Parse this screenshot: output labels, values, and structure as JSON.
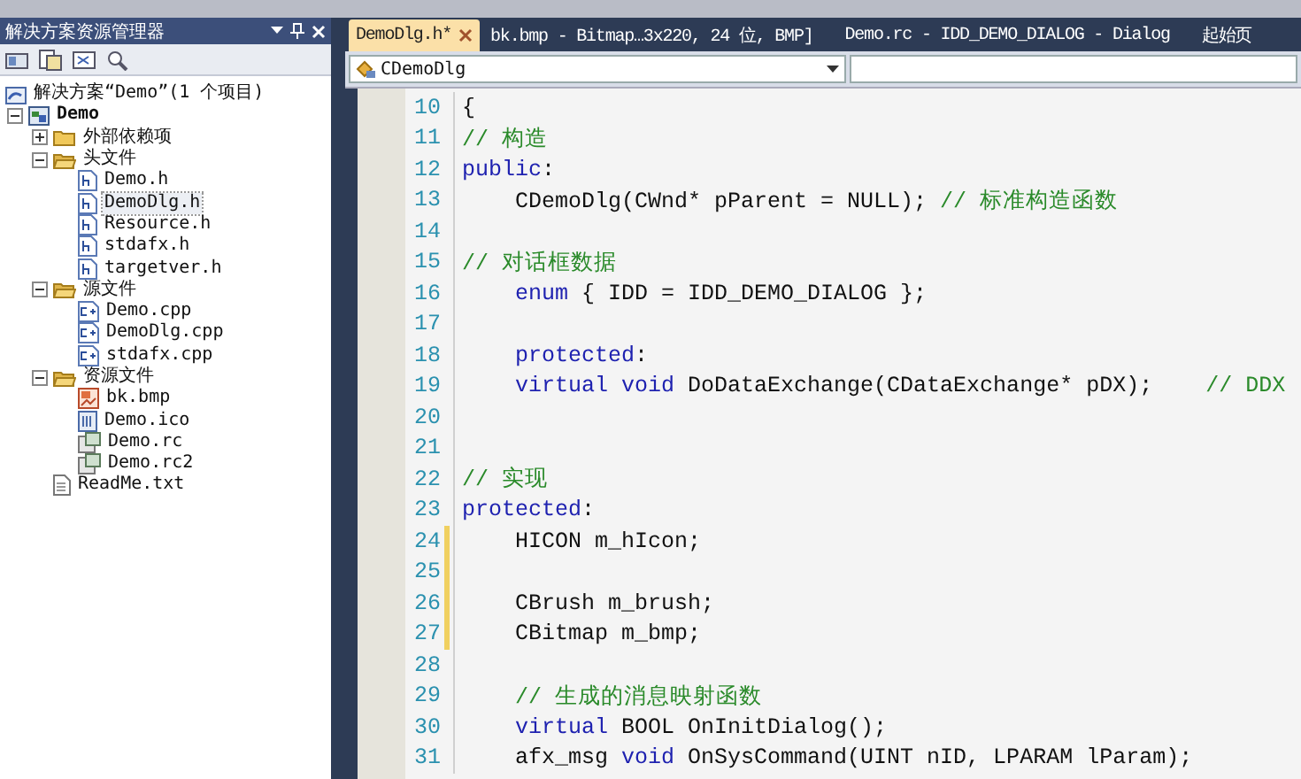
{
  "explorer": {
    "title": "解决方案资源管理器",
    "tree": [
      {
        "kind": "solution",
        "label": "解决方案“Demo”(1 个项目)",
        "selected": false,
        "children": [
          {
            "kind": "project",
            "label": "Demo",
            "selected": false,
            "expanded": true,
            "children": [
              {
                "kind": "folder",
                "label": "外部依赖项",
                "selected": false,
                "expanded": false
              },
              {
                "kind": "folder",
                "label": "头文件",
                "selected": false,
                "expanded": true,
                "children": [
                  {
                    "kind": "header",
                    "label": "Demo.h",
                    "selected": false
                  },
                  {
                    "kind": "header",
                    "label": "DemoDlg.h",
                    "selected": true
                  },
                  {
                    "kind": "header",
                    "label": "Resource.h",
                    "selected": false
                  },
                  {
                    "kind": "header",
                    "label": "stdafx.h",
                    "selected": false
                  },
                  {
                    "kind": "header",
                    "label": "targetver.h",
                    "selected": false
                  }
                ]
              },
              {
                "kind": "folder",
                "label": "源文件",
                "selected": false,
                "expanded": true,
                "children": [
                  {
                    "kind": "source",
                    "label": "Demo.cpp",
                    "selected": false
                  },
                  {
                    "kind": "source",
                    "label": "DemoDlg.cpp",
                    "selected": false
                  },
                  {
                    "kind": "source",
                    "label": "stdafx.cpp",
                    "selected": false
                  }
                ]
              },
              {
                "kind": "folder",
                "label": "资源文件",
                "selected": false,
                "expanded": true,
                "children": [
                  {
                    "kind": "bitmap",
                    "label": "bk.bmp",
                    "selected": false
                  },
                  {
                    "kind": "icon",
                    "label": "Demo.ico",
                    "selected": false
                  },
                  {
                    "kind": "resource",
                    "label": "Demo.rc",
                    "selected": false
                  },
                  {
                    "kind": "resource",
                    "label": "Demo.rc2",
                    "selected": false
                  }
                ]
              },
              {
                "kind": "text",
                "label": "ReadMe.txt",
                "selected": false
              }
            ]
          }
        ]
      }
    ]
  },
  "tabs": [
    {
      "label": "DemoDlg.h*",
      "selected": true
    },
    {
      "label": "bk.bmp - Bitmap…3x220, 24 位, BMP]",
      "selected": false
    },
    {
      "label": "Demo.rc - IDD_DEMO_DIALOG - Dialog",
      "selected": false
    },
    {
      "label": "起始页",
      "selected": false
    }
  ],
  "navigation": {
    "class_name": "CDemoDlg"
  },
  "code_lines": [
    {
      "number": "10",
      "changed": false,
      "tokens": [
        {
          "kind": "plain",
          "text": "{"
        }
      ]
    },
    {
      "number": "11",
      "changed": false,
      "tokens": [
        {
          "kind": "comment",
          "text": "// 构造"
        }
      ]
    },
    {
      "number": "12",
      "changed": false,
      "tokens": [
        {
          "kind": "keyword",
          "text": "public"
        },
        {
          "kind": "plain",
          "text": ":"
        }
      ]
    },
    {
      "number": "13",
      "changed": false,
      "tokens": [
        {
          "kind": "plain",
          "text": "    CDemoDlg(CWnd* pParent = NULL); "
        },
        {
          "kind": "comment",
          "text": "// 标准构造函数"
        }
      ]
    },
    {
      "number": "14",
      "changed": false
    },
    {
      "number": "15",
      "changed": false,
      "tokens": [
        {
          "kind": "comment",
          "text": "// 对话框数据"
        }
      ]
    },
    {
      "number": "16",
      "changed": false,
      "tokens": [
        {
          "kind": "keyword",
          "text": "    enum"
        },
        {
          "kind": "plain",
          "text": " { IDD = IDD_DEMO_DIALOG };"
        }
      ]
    },
    {
      "number": "17",
      "changed": false
    },
    {
      "number": "18",
      "changed": false,
      "tokens": [
        {
          "kind": "keyword",
          "text": "    protected"
        },
        {
          "kind": "plain",
          "text": ":"
        }
      ]
    },
    {
      "number": "19",
      "changed": false,
      "tokens": [
        {
          "kind": "keyword",
          "text": "    virtual void"
        },
        {
          "kind": "plain",
          "text": " DoDataExchange(CDataExchange* pDX);    "
        },
        {
          "kind": "comment",
          "text": "// DDX"
        }
      ]
    },
    {
      "number": "20",
      "changed": false
    },
    {
      "number": "21",
      "changed": false
    },
    {
      "number": "22",
      "changed": false,
      "tokens": [
        {
          "kind": "comment",
          "text": "// 实现"
        }
      ]
    },
    {
      "number": "23",
      "changed": false,
      "tokens": [
        {
          "kind": "keyword",
          "text": "protected"
        },
        {
          "kind": "plain",
          "text": ":"
        }
      ]
    },
    {
      "number": "24",
      "changed": true,
      "tokens": [
        {
          "kind": "plain",
          "text": "    HICON m_hIcon;"
        }
      ]
    },
    {
      "number": "25",
      "changed": true
    },
    {
      "number": "26",
      "changed": true,
      "tokens": [
        {
          "kind": "plain",
          "text": "    CBrush m_brush;"
        }
      ]
    },
    {
      "number": "27",
      "changed": true,
      "tokens": [
        {
          "kind": "plain",
          "text": "    CBitmap m_bmp;"
        }
      ]
    },
    {
      "number": "28",
      "changed": false
    },
    {
      "number": "29",
      "changed": false,
      "tokens": [
        {
          "kind": "comment",
          "text": "    // 生成的消息映射函数"
        }
      ]
    },
    {
      "number": "30",
      "changed": false,
      "tokens": [
        {
          "kind": "keyword",
          "text": "    virtual"
        },
        {
          "kind": "plain",
          "text": " BOOL OnInitDialog();"
        }
      ]
    },
    {
      "number": "31",
      "changed": false,
      "tokens": [
        {
          "kind": "plain",
          "text": "    afx_msg "
        },
        {
          "kind": "keyword",
          "text": "void"
        },
        {
          "kind": "plain",
          "text": " OnSysCommand(UINT nID, LPARAM lParam);"
        }
      ]
    }
  ]
}
